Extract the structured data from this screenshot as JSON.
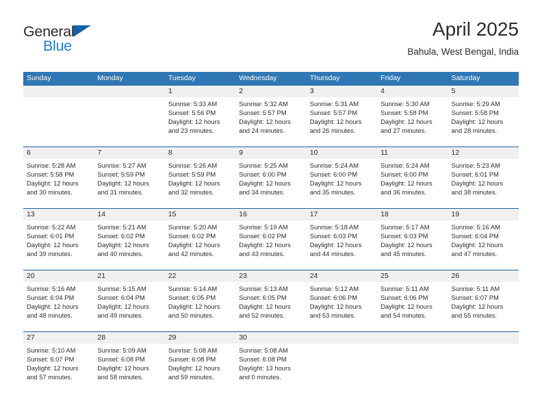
{
  "brand": {
    "name_part1": "General",
    "name_part2": "Blue",
    "triangle_color": "#1463a8",
    "blue_color": "#1a7fd4"
  },
  "header": {
    "title": "April 2025",
    "subtitle": "Bahula, West Bengal, India"
  },
  "theme": {
    "header_bg": "#3077b5",
    "row_divider": "#1f5fa0",
    "date_band_bg": "#f0f0f0",
    "text": "#2b2b2b"
  },
  "weekdays": [
    "Sunday",
    "Monday",
    "Tuesday",
    "Wednesday",
    "Thursday",
    "Friday",
    "Saturday"
  ],
  "weeks": [
    {
      "days": [
        {
          "num": "",
          "sunrise": "",
          "sunset": "",
          "daylight1": "",
          "daylight2": ""
        },
        {
          "num": "",
          "sunrise": "",
          "sunset": "",
          "daylight1": "",
          "daylight2": ""
        },
        {
          "num": "1",
          "sunrise": "Sunrise: 5:33 AM",
          "sunset": "Sunset: 5:56 PM",
          "daylight1": "Daylight: 12 hours",
          "daylight2": "and 23 minutes."
        },
        {
          "num": "2",
          "sunrise": "Sunrise: 5:32 AM",
          "sunset": "Sunset: 5:57 PM",
          "daylight1": "Daylight: 12 hours",
          "daylight2": "and 24 minutes."
        },
        {
          "num": "3",
          "sunrise": "Sunrise: 5:31 AM",
          "sunset": "Sunset: 5:57 PM",
          "daylight1": "Daylight: 12 hours",
          "daylight2": "and 26 minutes."
        },
        {
          "num": "4",
          "sunrise": "Sunrise: 5:30 AM",
          "sunset": "Sunset: 5:58 PM",
          "daylight1": "Daylight: 12 hours",
          "daylight2": "and 27 minutes."
        },
        {
          "num": "5",
          "sunrise": "Sunrise: 5:29 AM",
          "sunset": "Sunset: 5:58 PM",
          "daylight1": "Daylight: 12 hours",
          "daylight2": "and 28 minutes."
        }
      ]
    },
    {
      "days": [
        {
          "num": "6",
          "sunrise": "Sunrise: 5:28 AM",
          "sunset": "Sunset: 5:58 PM",
          "daylight1": "Daylight: 12 hours",
          "daylight2": "and 30 minutes."
        },
        {
          "num": "7",
          "sunrise": "Sunrise: 5:27 AM",
          "sunset": "Sunset: 5:59 PM",
          "daylight1": "Daylight: 12 hours",
          "daylight2": "and 31 minutes."
        },
        {
          "num": "8",
          "sunrise": "Sunrise: 5:26 AM",
          "sunset": "Sunset: 5:59 PM",
          "daylight1": "Daylight: 12 hours",
          "daylight2": "and 32 minutes."
        },
        {
          "num": "9",
          "sunrise": "Sunrise: 5:25 AM",
          "sunset": "Sunset: 6:00 PM",
          "daylight1": "Daylight: 12 hours",
          "daylight2": "and 34 minutes."
        },
        {
          "num": "10",
          "sunrise": "Sunrise: 5:24 AM",
          "sunset": "Sunset: 6:00 PM",
          "daylight1": "Daylight: 12 hours",
          "daylight2": "and 35 minutes."
        },
        {
          "num": "11",
          "sunrise": "Sunrise: 5:24 AM",
          "sunset": "Sunset: 6:00 PM",
          "daylight1": "Daylight: 12 hours",
          "daylight2": "and 36 minutes."
        },
        {
          "num": "12",
          "sunrise": "Sunrise: 5:23 AM",
          "sunset": "Sunset: 6:01 PM",
          "daylight1": "Daylight: 12 hours",
          "daylight2": "and 38 minutes."
        }
      ]
    },
    {
      "days": [
        {
          "num": "13",
          "sunrise": "Sunrise: 5:22 AM",
          "sunset": "Sunset: 6:01 PM",
          "daylight1": "Daylight: 12 hours",
          "daylight2": "and 39 minutes."
        },
        {
          "num": "14",
          "sunrise": "Sunrise: 5:21 AM",
          "sunset": "Sunset: 6:02 PM",
          "daylight1": "Daylight: 12 hours",
          "daylight2": "and 40 minutes."
        },
        {
          "num": "15",
          "sunrise": "Sunrise: 5:20 AM",
          "sunset": "Sunset: 6:02 PM",
          "daylight1": "Daylight: 12 hours",
          "daylight2": "and 42 minutes."
        },
        {
          "num": "16",
          "sunrise": "Sunrise: 5:19 AM",
          "sunset": "Sunset: 6:02 PM",
          "daylight1": "Daylight: 12 hours",
          "daylight2": "and 43 minutes."
        },
        {
          "num": "17",
          "sunrise": "Sunrise: 5:18 AM",
          "sunset": "Sunset: 6:03 PM",
          "daylight1": "Daylight: 12 hours",
          "daylight2": "and 44 minutes."
        },
        {
          "num": "18",
          "sunrise": "Sunrise: 5:17 AM",
          "sunset": "Sunset: 6:03 PM",
          "daylight1": "Daylight: 12 hours",
          "daylight2": "and 45 minutes."
        },
        {
          "num": "19",
          "sunrise": "Sunrise: 5:16 AM",
          "sunset": "Sunset: 6:04 PM",
          "daylight1": "Daylight: 12 hours",
          "daylight2": "and 47 minutes."
        }
      ]
    },
    {
      "days": [
        {
          "num": "20",
          "sunrise": "Sunrise: 5:16 AM",
          "sunset": "Sunset: 6:04 PM",
          "daylight1": "Daylight: 12 hours",
          "daylight2": "and 48 minutes."
        },
        {
          "num": "21",
          "sunrise": "Sunrise: 5:15 AM",
          "sunset": "Sunset: 6:04 PM",
          "daylight1": "Daylight: 12 hours",
          "daylight2": "and 49 minutes."
        },
        {
          "num": "22",
          "sunrise": "Sunrise: 5:14 AM",
          "sunset": "Sunset: 6:05 PM",
          "daylight1": "Daylight: 12 hours",
          "daylight2": "and 50 minutes."
        },
        {
          "num": "23",
          "sunrise": "Sunrise: 5:13 AM",
          "sunset": "Sunset: 6:05 PM",
          "daylight1": "Daylight: 12 hours",
          "daylight2": "and 52 minutes."
        },
        {
          "num": "24",
          "sunrise": "Sunrise: 5:12 AM",
          "sunset": "Sunset: 6:06 PM",
          "daylight1": "Daylight: 12 hours",
          "daylight2": "and 53 minutes."
        },
        {
          "num": "25",
          "sunrise": "Sunrise: 5:11 AM",
          "sunset": "Sunset: 6:06 PM",
          "daylight1": "Daylight: 12 hours",
          "daylight2": "and 54 minutes."
        },
        {
          "num": "26",
          "sunrise": "Sunrise: 5:11 AM",
          "sunset": "Sunset: 6:07 PM",
          "daylight1": "Daylight: 12 hours",
          "daylight2": "and 55 minutes."
        }
      ]
    },
    {
      "days": [
        {
          "num": "27",
          "sunrise": "Sunrise: 5:10 AM",
          "sunset": "Sunset: 6:07 PM",
          "daylight1": "Daylight: 12 hours",
          "daylight2": "and 57 minutes."
        },
        {
          "num": "28",
          "sunrise": "Sunrise: 5:09 AM",
          "sunset": "Sunset: 6:08 PM",
          "daylight1": "Daylight: 12 hours",
          "daylight2": "and 58 minutes."
        },
        {
          "num": "29",
          "sunrise": "Sunrise: 5:08 AM",
          "sunset": "Sunset: 6:08 PM",
          "daylight1": "Daylight: 12 hours",
          "daylight2": "and 59 minutes."
        },
        {
          "num": "30",
          "sunrise": "Sunrise: 5:08 AM",
          "sunset": "Sunset: 6:08 PM",
          "daylight1": "Daylight: 13 hours",
          "daylight2": "and 0 minutes."
        },
        {
          "num": "",
          "sunrise": "",
          "sunset": "",
          "daylight1": "",
          "daylight2": ""
        },
        {
          "num": "",
          "sunrise": "",
          "sunset": "",
          "daylight1": "",
          "daylight2": ""
        },
        {
          "num": "",
          "sunrise": "",
          "sunset": "",
          "daylight1": "",
          "daylight2": ""
        }
      ]
    }
  ]
}
